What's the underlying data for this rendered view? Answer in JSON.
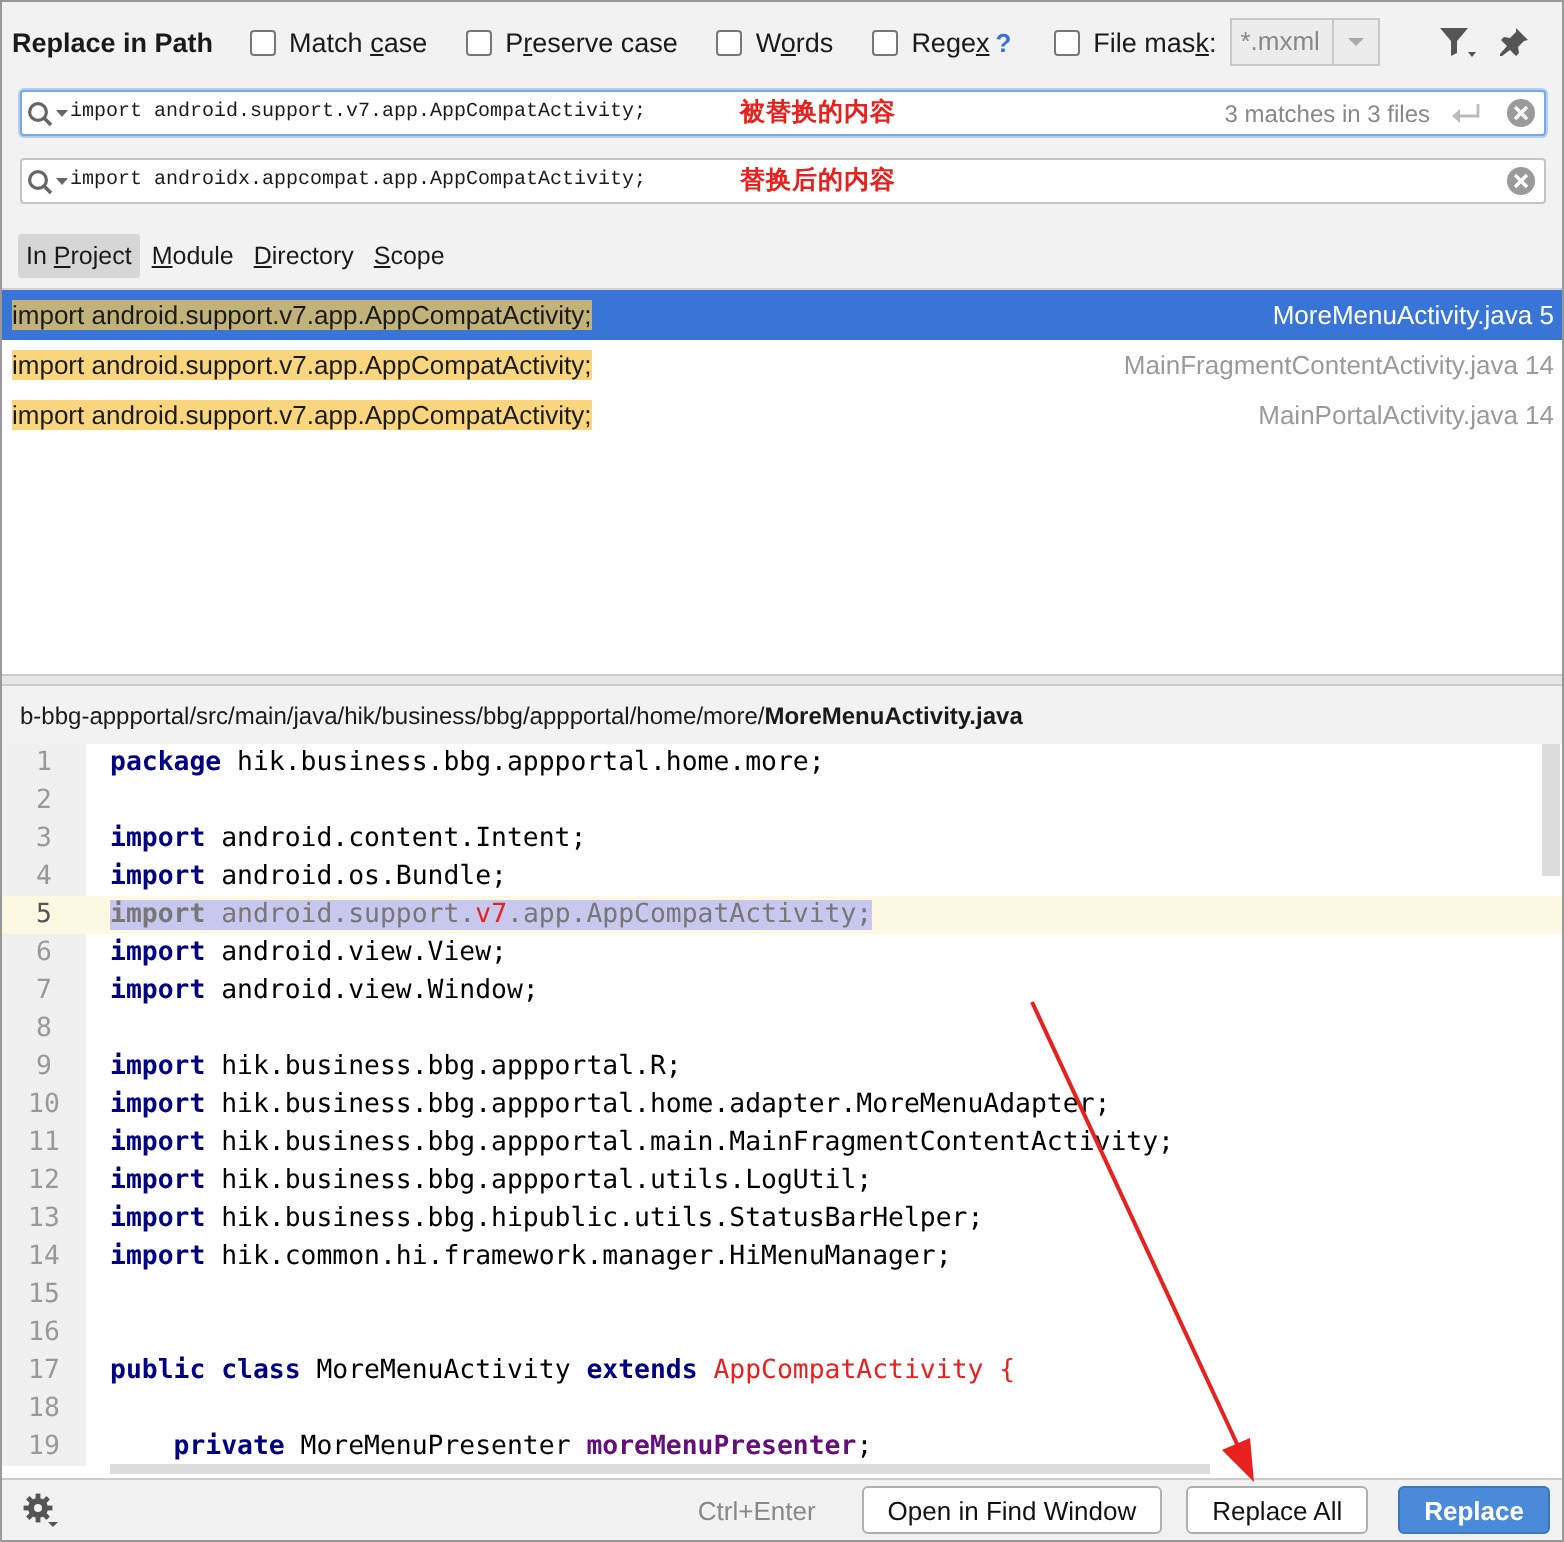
{
  "header": {
    "title": "Replace in Path",
    "options": [
      {
        "label_parts": [
          "Match ",
          "c",
          "ase"
        ],
        "checked": false
      },
      {
        "label_parts": [
          "P",
          "r",
          "eserve case"
        ],
        "checked": false
      },
      {
        "label_parts": [
          "W",
          "o",
          "rds"
        ],
        "checked": false
      },
      {
        "label_parts": [
          "Rege",
          "x"
        ],
        "checked": false,
        "help": "?"
      },
      {
        "label_parts": [
          "File mas",
          "k",
          ":"
        ],
        "checked": false
      }
    ],
    "file_mask": {
      "value": "*.mxml",
      "disabled": true
    }
  },
  "find_field": {
    "value": "import android.support.v7.app.AppCompatActivity;",
    "annotation": "被替换的内容",
    "matches": "3 matches in 3 files",
    "focused": true
  },
  "replace_field": {
    "value": "import androidx.appcompat.app.AppCompatActivity;",
    "annotation": "替换后的内容",
    "focused": false
  },
  "scopes": [
    {
      "label_parts": {
        "before": "In ",
        "key": "P",
        "after": "roject"
      },
      "selected": true
    },
    {
      "label_parts": {
        "key": "M",
        "after": "odule"
      },
      "selected": false
    },
    {
      "label_parts": {
        "key": "D",
        "after": "irectory"
      },
      "selected": false
    },
    {
      "label_parts": {
        "key": "S",
        "after": "cope"
      },
      "selected": false
    }
  ],
  "results": [
    {
      "text": "import android.support.v7.app.AppCompatActivity;",
      "file": "MoreMenuActivity.java 5",
      "selected": true
    },
    {
      "text": "import android.support.v7.app.AppCompatActivity;",
      "file": "MainFragmentContentActivity.java 14",
      "selected": false
    },
    {
      "text": "import android.support.v7.app.AppCompatActivity;",
      "file": "MainPortalActivity.java 14",
      "selected": false
    }
  ],
  "file_path": "b-bbg-appportal/src/main/java/hik/business/bbg/appportal/home/more/**MoreMenuActivity.java**",
  "editor": {
    "lines": [
      {
        "number": "1",
        "selected": false,
        "segments": [
          {
            "kind": "keyword",
            "text": "package"
          },
          {
            "kind": "plain",
            "text": " hik.business.bbg.appportal.home.more;"
          }
        ]
      },
      {
        "number": "2",
        "selected": false
      },
      {
        "number": "3",
        "selected": false,
        "segments": [
          {
            "kind": "keyword",
            "text": "import"
          },
          {
            "kind": "plain",
            "text": " android.content.Intent;"
          }
        ]
      },
      {
        "number": "4",
        "selected": false,
        "segments": [
          {
            "kind": "keyword",
            "text": "import"
          },
          {
            "kind": "plain",
            "text": " android.os.Bundle;"
          }
        ]
      },
      {
        "number": "5",
        "selected": true,
        "segments": [
          {
            "kind": "muted_keyword",
            "text": "import"
          },
          {
            "kind": "muted",
            "text": " android.support."
          },
          {
            "kind": "error",
            "text": "v7"
          },
          {
            "kind": "muted",
            "text": ".app.AppCompatActivity;"
          }
        ]
      },
      {
        "number": "6",
        "selected": false,
        "segments": [
          {
            "kind": "keyword",
            "text": "import"
          },
          {
            "kind": "plain",
            "text": " android.view.View;"
          }
        ]
      },
      {
        "number": "7",
        "selected": false,
        "segments": [
          {
            "kind": "keyword",
            "text": "import"
          },
          {
            "kind": "plain",
            "text": " android.view.Window;"
          }
        ]
      },
      {
        "number": "8",
        "selected": false
      },
      {
        "number": "9",
        "selected": false,
        "segments": [
          {
            "kind": "keyword",
            "text": "import"
          },
          {
            "kind": "plain",
            "text": " hik.business.bbg.appportal.R;"
          }
        ]
      },
      {
        "number": "10",
        "selected": false,
        "segments": [
          {
            "kind": "keyword",
            "text": "import"
          },
          {
            "kind": "plain",
            "text": " hik.business.bbg.appportal.home.adapter.MoreMenuAdapter;"
          }
        ]
      },
      {
        "number": "11",
        "selected": false,
        "segments": [
          {
            "kind": "keyword",
            "text": "import"
          },
          {
            "kind": "plain",
            "text": " hik.business.bbg.appportal.main.MainFragmentContentActivity;"
          }
        ]
      },
      {
        "number": "12",
        "selected": false,
        "segments": [
          {
            "kind": "keyword",
            "text": "import"
          },
          {
            "kind": "plain",
            "text": " hik.business.bbg.appportal.utils.LogUtil;"
          }
        ]
      },
      {
        "number": "13",
        "selected": false,
        "segments": [
          {
            "kind": "keyword",
            "text": "import"
          },
          {
            "kind": "plain",
            "text": " hik.business.bbg.hipublic.utils.StatusBarHelper;"
          }
        ]
      },
      {
        "number": "14",
        "selected": false,
        "segments": [
          {
            "kind": "keyword",
            "text": "import"
          },
          {
            "kind": "plain",
            "text": " hik.common.hi.framework.manager.HiMenuManager;"
          }
        ]
      },
      {
        "number": "15",
        "selected": false
      },
      {
        "number": "16",
        "selected": false
      },
      {
        "number": "17",
        "selected": false,
        "segments": [
          {
            "kind": "keyword",
            "text": "public class"
          },
          {
            "kind": "plain",
            "text": " MoreMenuActivity "
          },
          {
            "kind": "keyword",
            "text": "extends"
          },
          {
            "kind": "error",
            "text": " AppCompatActivity {"
          }
        ]
      },
      {
        "number": "18",
        "selected": false
      },
      {
        "number": "19",
        "selected": false,
        "segments": [
          {
            "kind": "keyword",
            "text": "    private"
          },
          {
            "kind": "plain",
            "text": " MoreMenuPresenter "
          },
          {
            "kind": "field",
            "text": "moreMenuPresenter"
          },
          {
            "kind": "plain",
            "text": ";"
          }
        ]
      }
    ]
  },
  "footer": {
    "shortcut": "Ctrl+Enter",
    "buttons": [
      {
        "label": "Open in Find Window",
        "kind": "default"
      },
      {
        "label": "Replace All",
        "kind": "default"
      },
      {
        "label": "Replace",
        "kind": "primary"
      }
    ]
  }
}
